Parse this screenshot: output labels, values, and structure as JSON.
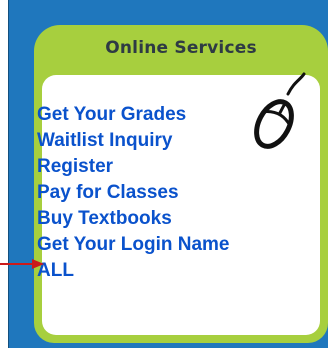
{
  "widget": {
    "title": "Online Services",
    "icon": "computer-mouse-icon",
    "pointer_icon": "red-arrow-icon",
    "colors": {
      "panel_blue": "#1f77bd",
      "card_green": "#a7cf3e",
      "link_blue": "#0a52cc",
      "arrow_red": "#cc1a1a"
    }
  },
  "links": [
    {
      "label": "Get Your Grades"
    },
    {
      "label": "Waitlist Inquiry"
    },
    {
      "label": "Register"
    },
    {
      "label": "Pay for Classes"
    },
    {
      "label": "Buy Textbooks"
    },
    {
      "label": "Get Your Login Name"
    },
    {
      "label": "ALL"
    }
  ]
}
